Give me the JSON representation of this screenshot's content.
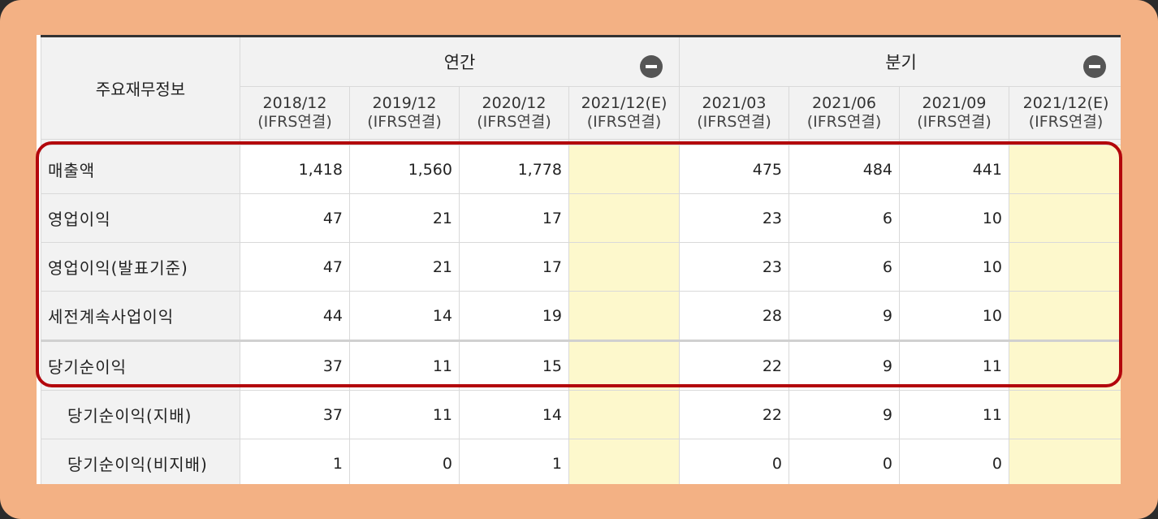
{
  "table": {
    "title": "주요재무정보",
    "groups": [
      {
        "label": "연간",
        "icon": "minus-circle-icon"
      },
      {
        "label": "분기",
        "icon": "minus-circle-icon"
      }
    ],
    "periods": [
      {
        "date": "2018/12",
        "basis": "(IFRS연결)"
      },
      {
        "date": "2019/12",
        "basis": "(IFRS연결)"
      },
      {
        "date": "2020/12",
        "basis": "(IFRS연결)"
      },
      {
        "date": "2021/12(E)",
        "basis": "(IFRS연결)"
      },
      {
        "date": "2021/03",
        "basis": "(IFRS연결)"
      },
      {
        "date": "2021/06",
        "basis": "(IFRS연결)"
      },
      {
        "date": "2021/09",
        "basis": "(IFRS연결)"
      },
      {
        "date": "2021/12(E)",
        "basis": "(IFRS연결)"
      }
    ],
    "rows": [
      {
        "label": "매출액",
        "values": [
          "1,418",
          "1,560",
          "1,778",
          "",
          "475",
          "484",
          "441",
          ""
        ]
      },
      {
        "label": "영업이익",
        "values": [
          "47",
          "21",
          "17",
          "",
          "23",
          "6",
          "10",
          ""
        ]
      },
      {
        "label": "영업이익(발표기준)",
        "values": [
          "47",
          "21",
          "17",
          "",
          "23",
          "6",
          "10",
          ""
        ]
      },
      {
        "label": "세전계속사업이익",
        "values": [
          "44",
          "14",
          "19",
          "",
          "28",
          "9",
          "10",
          ""
        ]
      },
      {
        "label": "당기순이익",
        "values": [
          "37",
          "11",
          "15",
          "",
          "22",
          "9",
          "11",
          ""
        ]
      },
      {
        "label": "당기순이익(지배)",
        "values": [
          "37",
          "11",
          "14",
          "",
          "22",
          "9",
          "11",
          ""
        ]
      },
      {
        "label": "당기순이익(비지배)",
        "values": [
          "1",
          "0",
          "1",
          "",
          "0",
          "0",
          "0",
          ""
        ]
      }
    ]
  },
  "colors": {
    "frame": "#f3b184",
    "highlight": "#b3070c",
    "estimate_cell": "#fdf8cc"
  }
}
